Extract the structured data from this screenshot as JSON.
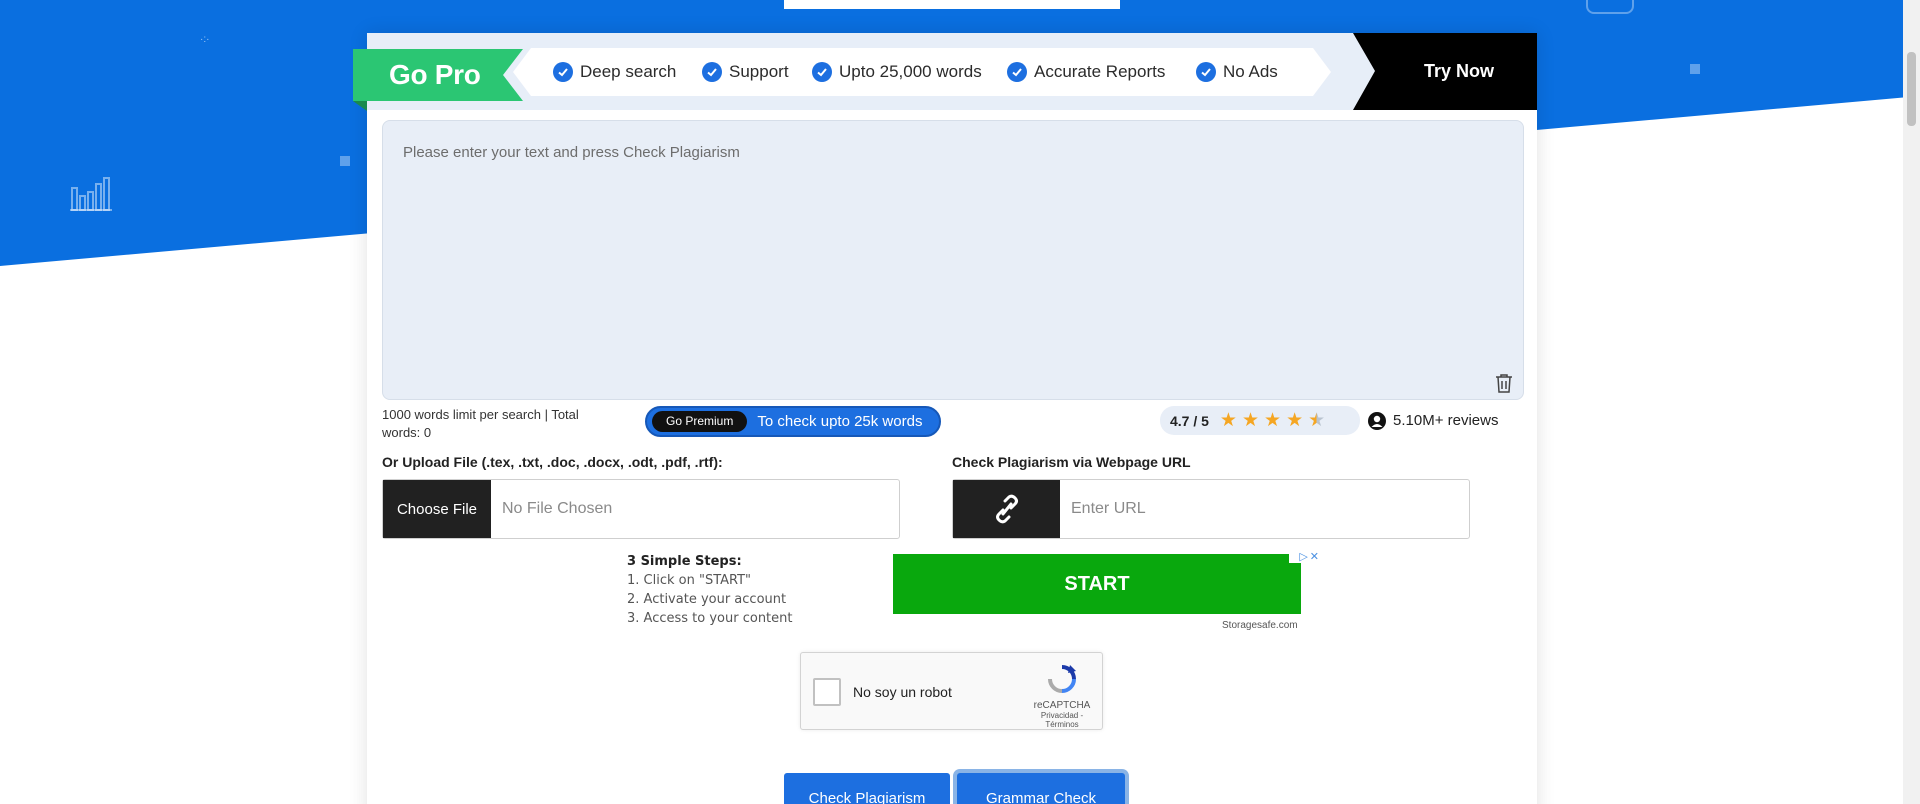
{
  "banner": {
    "gopro_label": "Go Pro",
    "features": [
      "Deep search",
      "Support",
      "Upto 25,000 words",
      "Accurate Reports",
      "No Ads"
    ],
    "try_now_label": "Try Now"
  },
  "editor": {
    "placeholder": "Please enter your text and press Check Plagiarism",
    "word_limit_text": "1000 words limit per search | Total words: 0"
  },
  "premium": {
    "button_label": "Go Premium",
    "text": "To check upto 25k words"
  },
  "rating": {
    "score": "4.7 / 5",
    "stars": 4.5,
    "reviews": "5.10M+ reviews"
  },
  "upload": {
    "label": "Or Upload File (.tex, .txt, .doc, .docx, .odt, .pdf, .rtf):",
    "choose_label": "Choose File",
    "no_file_text": "No File Chosen"
  },
  "url_check": {
    "label": "Check Plagiarism via Webpage URL",
    "placeholder": "Enter URL"
  },
  "ad": {
    "title": "3 Simple Steps:",
    "steps": [
      "1. Click on \"START\"",
      "2. Activate your account",
      "3. Access to your content"
    ],
    "button_label": "START",
    "domain": "Storagesafe.com"
  },
  "captcha": {
    "label": "No soy un robot",
    "brand": "reCAPTCHA",
    "links": "Privacidad - Términos"
  },
  "actions": {
    "check_label": "Check Plagiarism",
    "grammar_label": "Grammar Check"
  },
  "colors": {
    "primary_blue": "#1d6fe0",
    "go_pro_green": "#2bc673",
    "ad_green": "#09a80d"
  }
}
